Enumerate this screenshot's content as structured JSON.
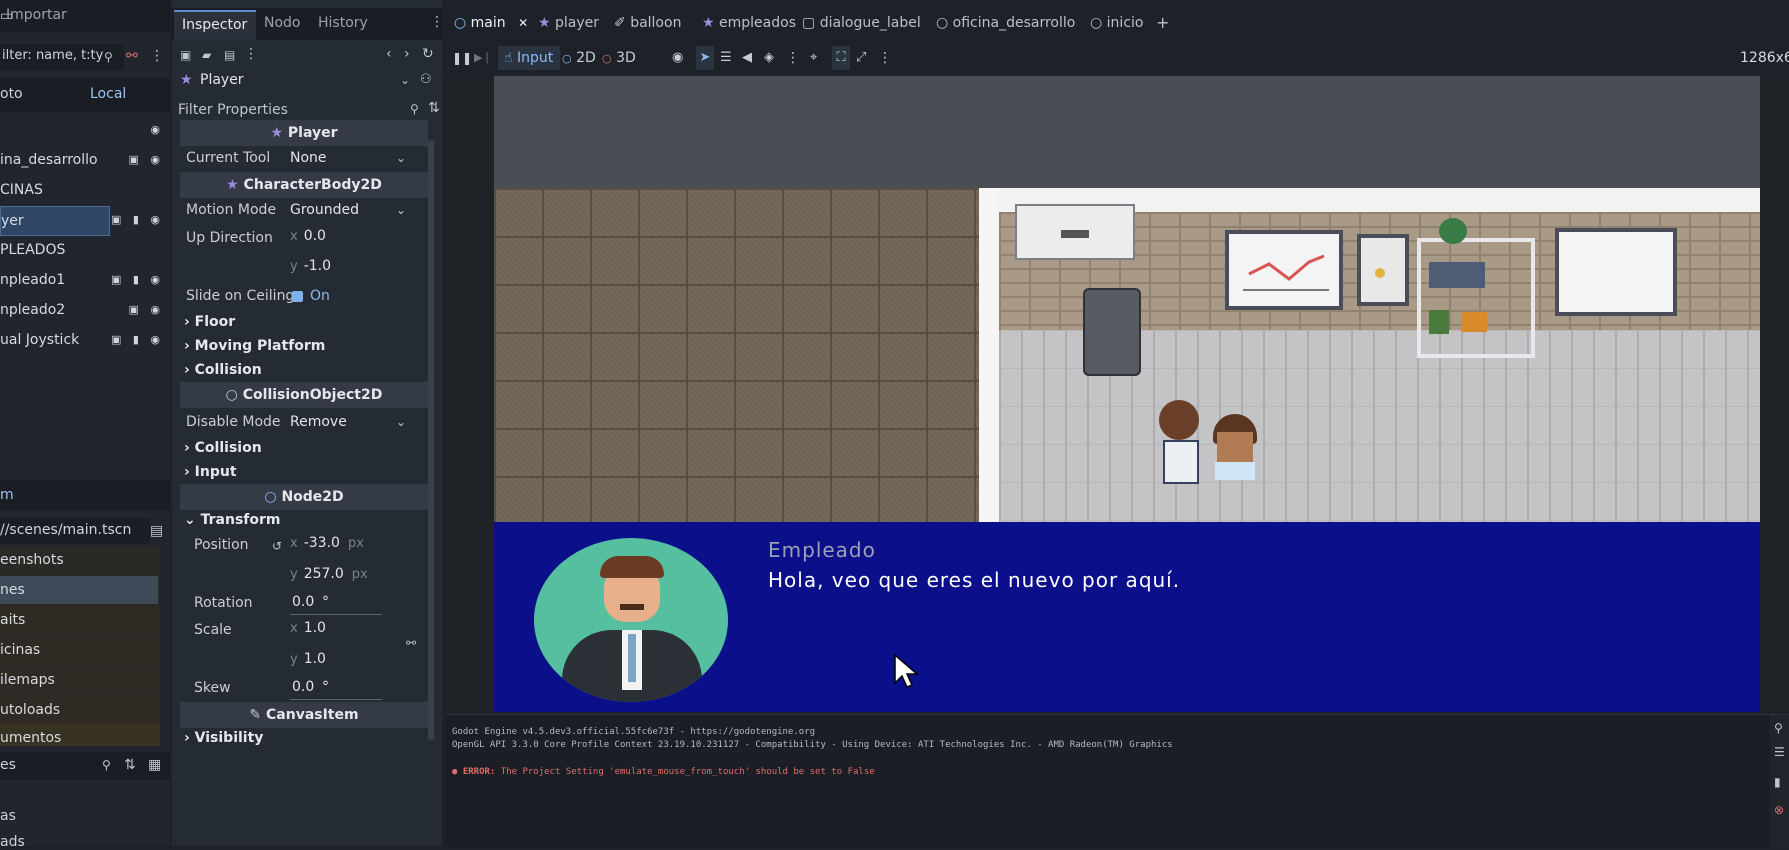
{
  "left_dock": {
    "tab_import": "Importar",
    "filter_placeholder": "ilter: name, t:ty",
    "tab_remote": "oto",
    "tab_local": "Local",
    "tree": [
      {
        "label": "",
        "icons": "◉"
      },
      {
        "label": "ina_desarrollo",
        "icons": "▣ ◉"
      },
      {
        "label": "CINAS",
        "icons": ""
      },
      {
        "label": "yer",
        "icons": "▣ ▮ ◉"
      },
      {
        "label": "PLEADOS",
        "icons": ""
      },
      {
        "label": "npleado1",
        "icons": "▣ ▮ ◉"
      },
      {
        "label": "npleado2",
        "icons": "▣ ◉"
      },
      {
        "label": "ual Joystick",
        "icons": "▣ ▮ ◉"
      }
    ],
    "fs_tab": "m",
    "fs_path": "//scenes/main.tscn",
    "fs_items": [
      "eenshots",
      "nes",
      "aits",
      "icinas",
      "ilemaps",
      "utoloads",
      "umentos"
    ],
    "fs_filter_label": "es",
    "bottom_items": [
      "as",
      "ads"
    ]
  },
  "inspector": {
    "tabs": [
      "Inspector",
      "Nodo",
      "History"
    ],
    "node_name": "Player",
    "filter_placeholder": "Filter Properties",
    "sections": {
      "player": "Player",
      "characterbody": "CharacterBody2D",
      "collisionobject": "CollisionObject2D",
      "node2d": "Node2D",
      "canvasitem": "CanvasItem"
    },
    "current_tool_label": "Current Tool",
    "current_tool_value": "None",
    "motion_mode_label": "Motion Mode",
    "motion_mode_value": "Grounded",
    "up_direction_label": "Up Direction",
    "up_x": "0.0",
    "up_y": "-1.0",
    "slide_label": "Slide on Ceiling",
    "slide_value": "On",
    "floor": "Floor",
    "moving_platform": "Moving Platform",
    "collision": "Collision",
    "disable_mode_label": "Disable Mode",
    "disable_mode_value": "Remove",
    "collision2": "Collision",
    "input": "Input",
    "transform": "Transform",
    "position_label": "Position",
    "pos_x": "-33.0",
    "pos_y": "257.0",
    "unit_px": "px",
    "rotation_label": "Rotation",
    "rotation_value": "0.0",
    "degree": "°",
    "scale_label": "Scale",
    "scale_x": "1.0",
    "scale_y": "1.0",
    "skew_label": "Skew",
    "skew_value": "0.0",
    "visibility": "Visibility",
    "axis_x": "x",
    "axis_y": "y"
  },
  "editor": {
    "tabs": [
      {
        "label": "main",
        "icon": "○"
      },
      {
        "label": "player",
        "icon": "★"
      },
      {
        "label": "balloon",
        "icon": "✐"
      },
      {
        "label": "empleados",
        "icon": "★"
      },
      {
        "label": "dialogue_label",
        "icon": "▢"
      },
      {
        "label": "oficina_desarrollo",
        "icon": "○"
      },
      {
        "label": "inicio",
        "icon": "○"
      }
    ],
    "add_tab": "+",
    "close_tab": "✕",
    "toolbar": {
      "input": "Input",
      "mode_2d": "2D",
      "mode_3d": "3D",
      "resolution": "1286x6"
    }
  },
  "game": {
    "speaker": "Empleado",
    "line": "Hola, veo que eres el nuevo por aquí."
  },
  "output": {
    "line1": "Godot Engine v4.5.dev3.official.55fc6e73f - https://godotengine.org",
    "line2": "OpenGL API 3.3.0 Core Profile Context 23.19.10.231127 - Compatibility - Using Device: ATI Technologies Inc. - AMD Radeon(TM) Graphics",
    "error_prefix": "ERROR:",
    "error_text": "The Project Setting 'emulate_mouse_from_touch' should be set to False"
  }
}
